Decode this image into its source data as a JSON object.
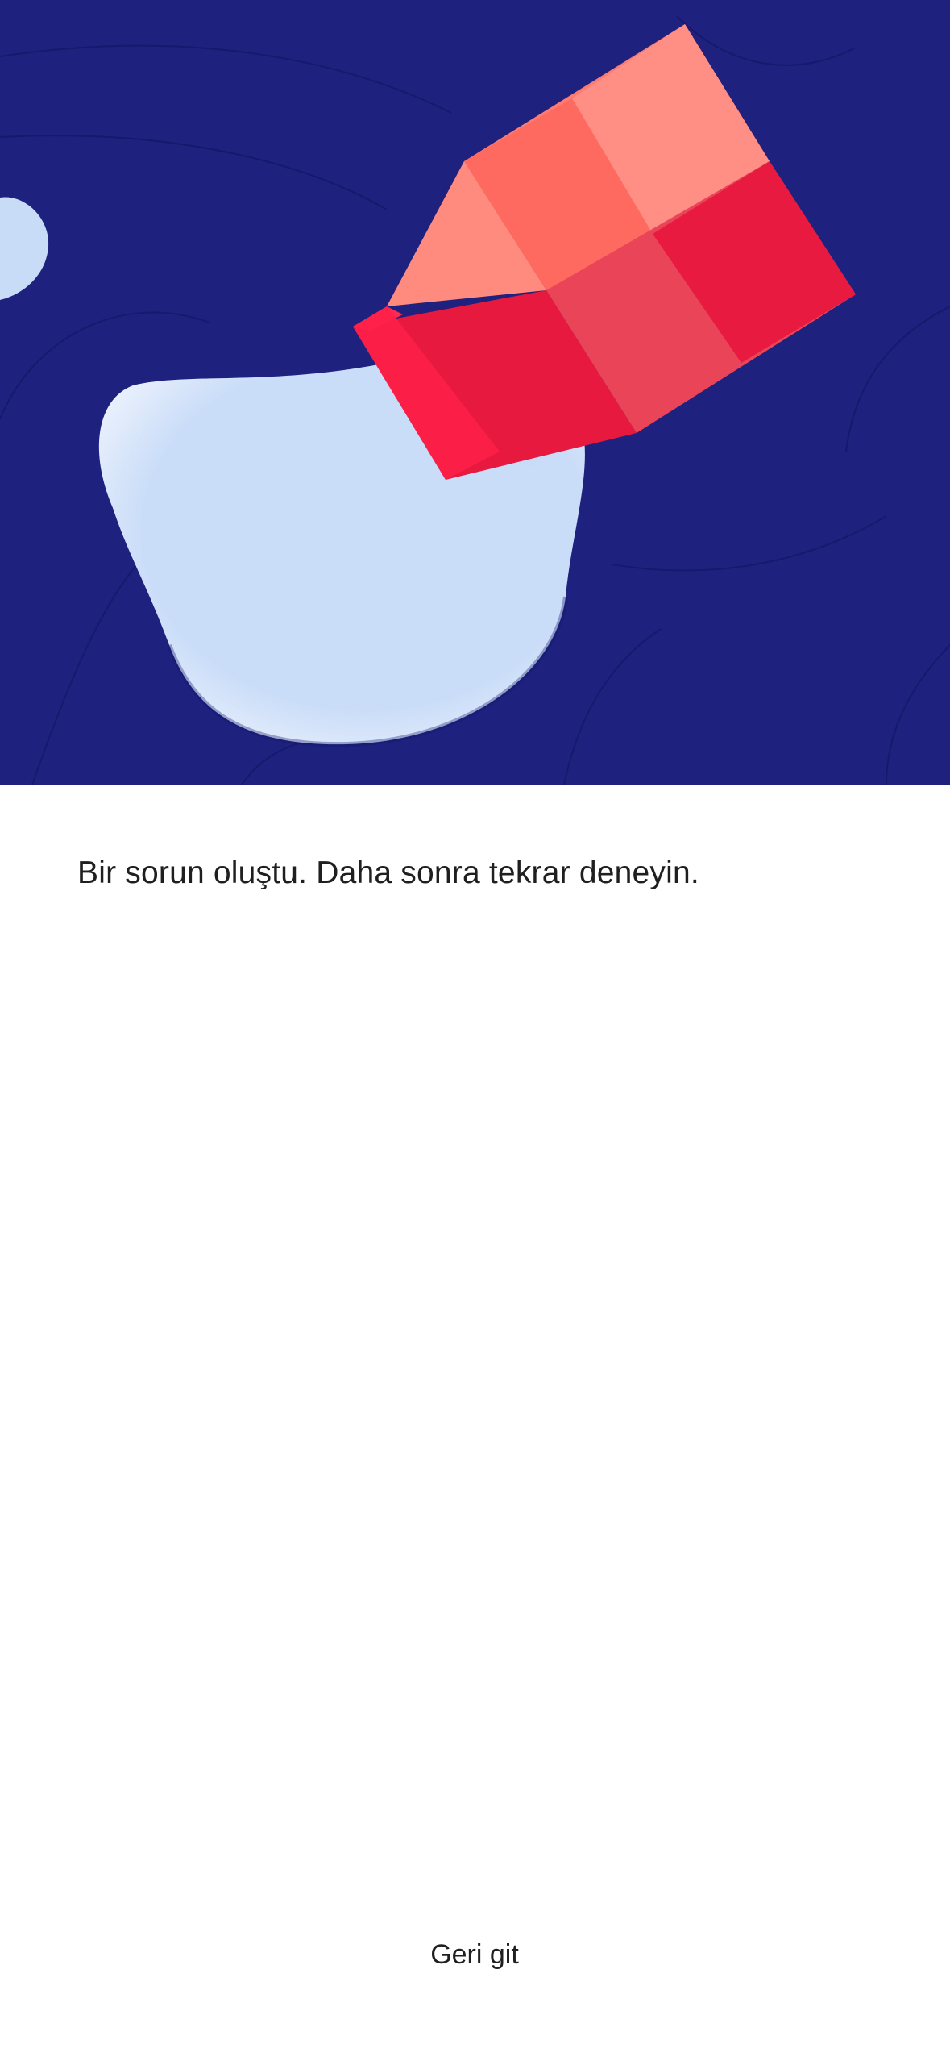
{
  "hero": {
    "illustration": "milk-carton-spill-illustration",
    "colors": {
      "background": "#1e217e",
      "milk": "#c8dbf7",
      "carton_light": "#ff8a80",
      "carton_mid": "#ff6b63",
      "carton_dark": "#e8193f"
    }
  },
  "error": {
    "message": "Bir sorun oluştu. Daha sonra tekrar deneyin."
  },
  "actions": {
    "back_label": "Geri git"
  }
}
